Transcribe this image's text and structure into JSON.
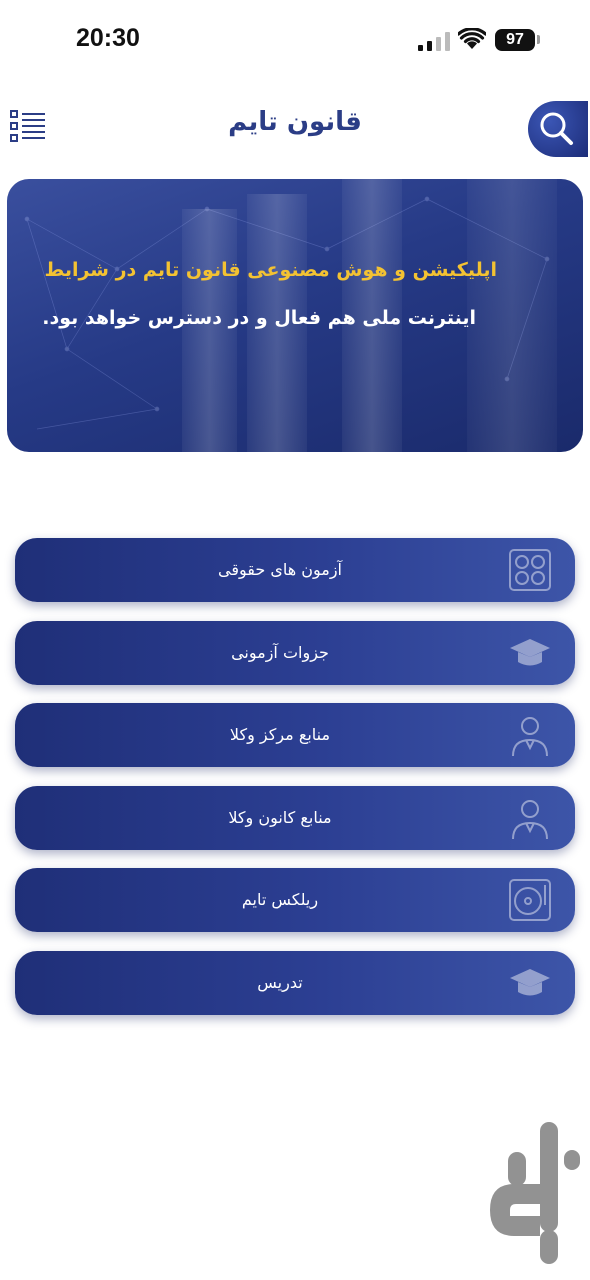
{
  "status_bar": {
    "time": "20:30",
    "battery": "97"
  },
  "header": {
    "title": "قانون تایم"
  },
  "banner": {
    "line1": "اپلیکیشن و هوش مصنوعی قانون تایم در شرایط",
    "line2": "اینترنت ملی هم فعال و در دسترس خواهد بود."
  },
  "menu": [
    {
      "label": "آزمون های حقوقی",
      "icon": "answer-sheet-icon"
    },
    {
      "label": "جزوات آزمونی",
      "icon": "graduation-cap-icon"
    },
    {
      "label": "منابع مرکز وکلا",
      "icon": "lawyer-icon"
    },
    {
      "label": "منابع کانون وکلا",
      "icon": "lawyer-icon"
    },
    {
      "label": "ریلکس تایم",
      "icon": "turntable-icon"
    },
    {
      "label": "تدریس",
      "icon": "graduation-cap-icon"
    }
  ],
  "colors": {
    "primary": "#2b3d86",
    "accent": "#f3c232"
  }
}
